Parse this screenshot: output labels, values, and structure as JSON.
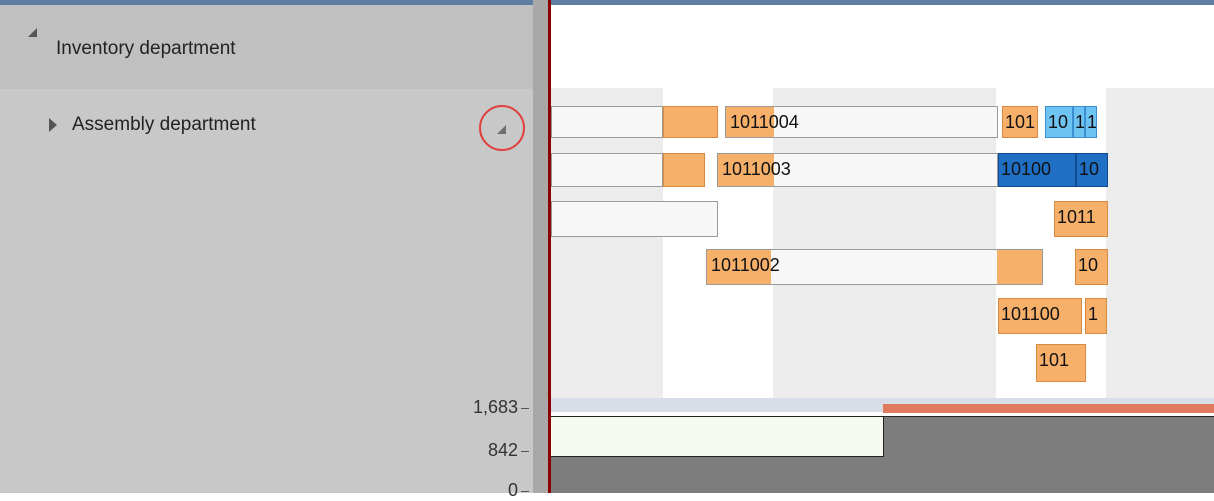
{
  "tree": {
    "group": {
      "label": "Inventory department",
      "expanded": true
    },
    "child": {
      "label": "Assembly department",
      "expanded": false
    }
  },
  "gantt": {
    "bars": [
      {
        "id": "r1-white-a",
        "label": "",
        "color": "white"
      },
      {
        "id": "r1-orange-a",
        "label": "",
        "color": "orange"
      },
      {
        "id": "r1-1011004",
        "label": "1011004",
        "color": "orange-white"
      },
      {
        "id": "r1-101",
        "label": "101",
        "color": "orange"
      },
      {
        "id": "r1-10-lb",
        "label": "10",
        "color": "lightblue"
      },
      {
        "id": "r1-1-lb",
        "label": "1",
        "color": "lightblue"
      },
      {
        "id": "r1-1-lb2",
        "label": "1",
        "color": "lightblue"
      },
      {
        "id": "r2-white-a",
        "label": "",
        "color": "white"
      },
      {
        "id": "r2-orange-a",
        "label": "",
        "color": "orange"
      },
      {
        "id": "r2-1011003",
        "label": "1011003",
        "color": "orange-white"
      },
      {
        "id": "r2-10100",
        "label": "10100",
        "color": "darkblue"
      },
      {
        "id": "r2-10",
        "label": "10",
        "color": "darkblue"
      },
      {
        "id": "r3-white-a",
        "label": "",
        "color": "white"
      },
      {
        "id": "r3-1011",
        "label": "1011",
        "color": "orange"
      },
      {
        "id": "r4-1011002",
        "label": "1011002",
        "color": "orange-white"
      },
      {
        "id": "r4-10",
        "label": "10",
        "color": "orange"
      },
      {
        "id": "r5-101100",
        "label": "101100",
        "color": "orange"
      },
      {
        "id": "r5-1",
        "label": "1",
        "color": "orange"
      },
      {
        "id": "r6-101",
        "label": "101",
        "color": "orange"
      }
    ]
  },
  "load_chart": {
    "y_ticks": [
      "1,683",
      "842",
      "0"
    ]
  },
  "colors": {
    "accent_orange": "#f6b06a",
    "accent_lightblue": "#6fc3f2",
    "accent_darkblue": "#1f6fc4",
    "overload": "#e07a5f",
    "timeline_marker": "#8b0000"
  }
}
